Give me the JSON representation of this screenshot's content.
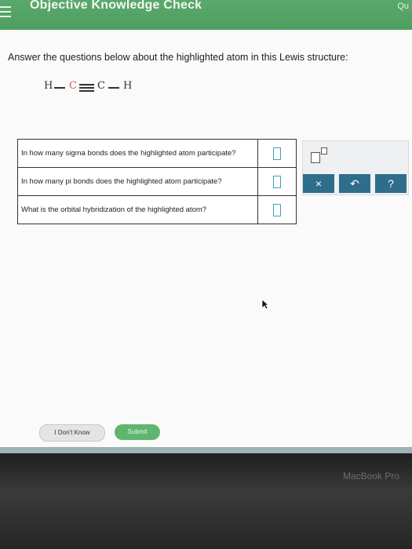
{
  "app": {
    "title": "Objective Knowledge Check",
    "top_right_text": "Qu"
  },
  "instruction": "Answer the questions below about the highlighted atom in this Lewis structure:",
  "lewis_structure": {
    "atoms": [
      "H",
      "C",
      "C",
      "H"
    ],
    "highlight_color": "#d9534f",
    "highlighted_atom_index": 1
  },
  "questions": [
    {
      "text": "In how many sigma bonds does the highlighted atom participate?",
      "answer": ""
    },
    {
      "text": "In how many pi bonds does the highlighted atom participate?",
      "answer": ""
    },
    {
      "text": "What is the orbital hybridization of the highlighted atom?",
      "answer": ""
    }
  ],
  "tools": {
    "superscript_icon": "superscript-icon",
    "clear_label": "×",
    "undo_label": "↶",
    "help_label": "?"
  },
  "buttons": {
    "dont_know": "I Don't Know",
    "submit": "Submit"
  },
  "device": {
    "label": "MacBook Pro"
  },
  "colors": {
    "header_green": "#55a366",
    "tool_blue": "#2f6e8a",
    "submit_green": "#5fb56f",
    "answer_border": "#3aa0c0"
  }
}
